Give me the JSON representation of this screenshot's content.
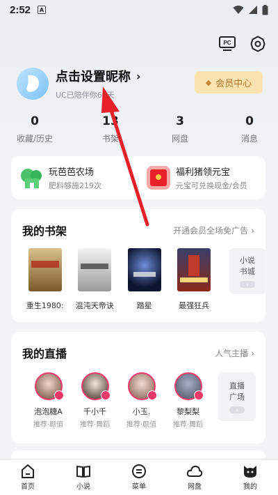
{
  "status": {
    "time": "2:52",
    "notification_letter": "A"
  },
  "profile": {
    "nickname": "点击设置昵称",
    "days_text": "UC已陪伴你62天"
  },
  "vip_button": "会员中心",
  "stats": [
    {
      "value": "0",
      "label": "收藏/历史"
    },
    {
      "value": "13",
      "label": "书架"
    },
    {
      "value": "3",
      "label": "网盘"
    },
    {
      "value": "0",
      "label": "消息"
    }
  ],
  "promos": [
    {
      "title": "玩芭芭农场",
      "subtitle": "肥料够施219次",
      "icon": "farm-house-icon"
    },
    {
      "title": "福利猪领元宝",
      "subtitle": "元宝可兑换现金/会员",
      "icon": "red-envelope-icon"
    }
  ],
  "shelf": {
    "title": "我的书架",
    "link": "开通会员全场免广告",
    "books": [
      {
        "title": "重生1980:"
      },
      {
        "title": "混沌天帝诀"
      },
      {
        "title": "踏星"
      },
      {
        "title": "最强狂兵"
      }
    ],
    "more_label_1": "小说",
    "more_label_2": "书城"
  },
  "live": {
    "title": "我的直播",
    "link": "人气主播",
    "streamers": [
      {
        "name": "泡泡糖A",
        "tag": "推荐·颜值"
      },
      {
        "name": "千小千",
        "tag": "推荐·舞蹈"
      },
      {
        "name": "小玉.",
        "tag": "推荐·颜值"
      },
      {
        "name": "黎梨梨",
        "tag": "推荐·舞蹈"
      }
    ],
    "more_label_1": "直播",
    "more_label_2": "广场"
  },
  "tabs": [
    {
      "label": "首页",
      "icon": "home-icon"
    },
    {
      "label": "小说",
      "icon": "book-icon"
    },
    {
      "label": "菜单",
      "icon": "menu-icon"
    },
    {
      "label": "网盘",
      "icon": "cloud-icon"
    },
    {
      "label": "我的",
      "icon": "profile-cat-icon"
    }
  ],
  "colors": {
    "accent_red": "#e8202a",
    "live_pink": "#f0386b",
    "vip_gold": "#b4742a"
  }
}
